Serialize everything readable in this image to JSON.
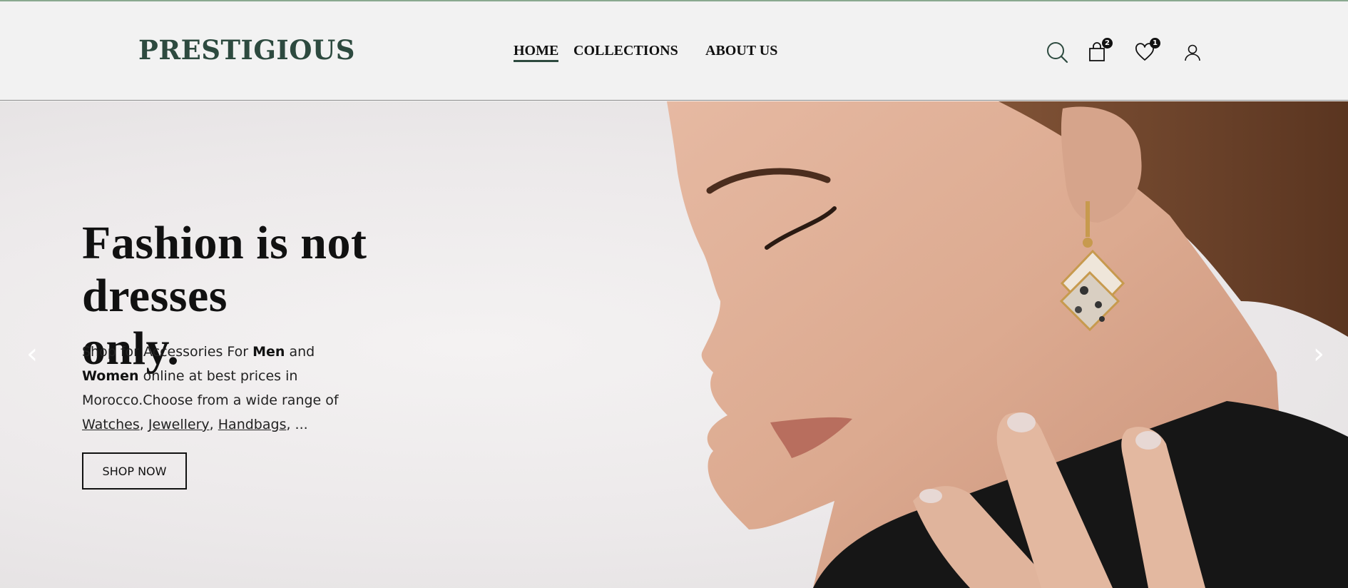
{
  "brand": {
    "logo": "PRESTIGIOUS",
    "accent": "#2d4a3f"
  },
  "nav": {
    "items": [
      {
        "label": "HOME",
        "active": true
      },
      {
        "label": "COLLECTIONS",
        "active": false
      },
      {
        "label": "ABOUT US",
        "active": false
      }
    ]
  },
  "header_icons": {
    "search": {
      "icon": "search-icon"
    },
    "cart": {
      "icon": "shopping-bag-icon",
      "count": "2"
    },
    "wishlist": {
      "icon": "heart-icon",
      "count": "1"
    },
    "account": {
      "icon": "user-icon"
    }
  },
  "hero": {
    "headline_line1": "Fashion is not dresses",
    "headline_line2": "only.",
    "sub": {
      "t1": "Shop for Accessories For ",
      "men": "Men",
      "t2": " and ",
      "women": "Women",
      "t3": " online at best prices in Morocco.Choose from a wide range of ",
      "link1": "Watches",
      "sep1": ", ",
      "link2": "Jewellery",
      "sep2": ", ",
      "link3": "Handbags",
      "t4": ", ..."
    },
    "cta": "SHOP NOW",
    "prev_arrow": "‹",
    "next_arrow": "›"
  }
}
